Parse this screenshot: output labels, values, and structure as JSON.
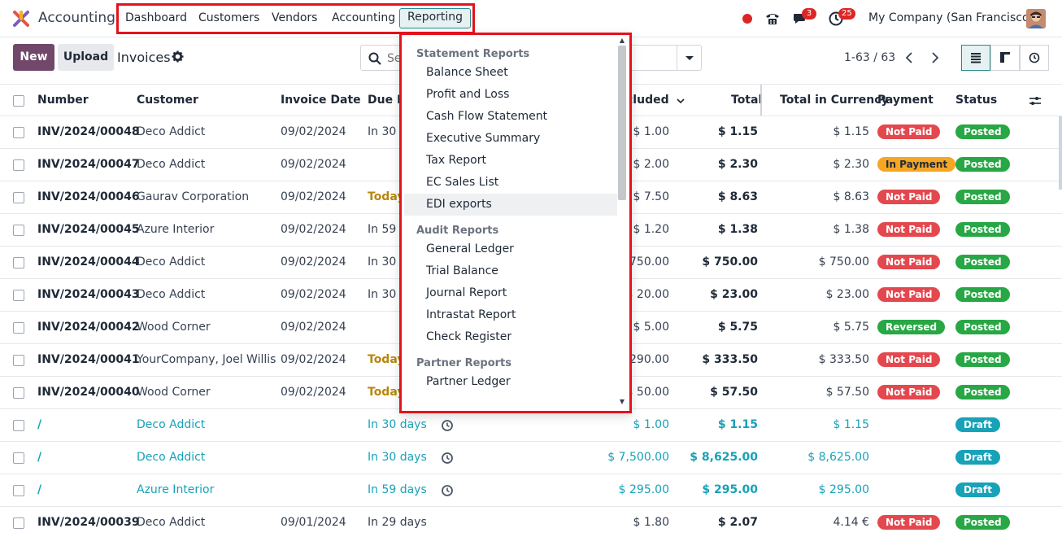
{
  "app": {
    "name": "Accounting",
    "menu": [
      "Dashboard",
      "Customers",
      "Vendors",
      "Accounting",
      "Reporting"
    ],
    "active_menu": "Reporting",
    "chat_count": "3",
    "activity_count": "25",
    "company": "My Company (San Francisco)"
  },
  "control": {
    "new_label": "New",
    "upload_label": "Upload",
    "breadcrumb": "Invoices",
    "search_placeholder": "Se",
    "pager": "1-63 / 63"
  },
  "table": {
    "columns": [
      "Number",
      "Customer",
      "Invoice Date",
      "Due D",
      "cluded",
      "Total",
      "Total in Currency",
      "Payment",
      "Status"
    ],
    "rows": [
      {
        "number": "INV/2024/00048",
        "customer": "Deco Addict",
        "date": "09/02/2024",
        "due": "In 30 d",
        "due_style": "",
        "tax_excl": "$ 1.00",
        "total": "$ 1.15",
        "currency": "$ 1.15",
        "payment": "Not Paid",
        "status": "Posted"
      },
      {
        "number": "INV/2024/00047",
        "customer": "Deco Addict",
        "date": "09/02/2024",
        "due": "",
        "due_style": "",
        "tax_excl": "$ 2.00",
        "total": "$ 2.30",
        "currency": "$ 2.30",
        "payment": "In Payment",
        "status": "Posted"
      },
      {
        "number": "INV/2024/00046",
        "customer": "Gaurav Corporation",
        "date": "09/02/2024",
        "due": "Today",
        "due_style": "today",
        "tax_excl": "$ 7.50",
        "total": "$ 8.63",
        "currency": "$ 8.63",
        "payment": "Not Paid",
        "status": "Posted"
      },
      {
        "number": "INV/2024/00045",
        "customer": "Azure Interior",
        "date": "09/02/2024",
        "due": "In 59 d",
        "due_style": "",
        "tax_excl": "$ 1.20",
        "total": "$ 1.38",
        "currency": "$ 1.38",
        "payment": "Not Paid",
        "status": "Posted"
      },
      {
        "number": "INV/2024/00044",
        "customer": "Deco Addict",
        "date": "09/02/2024",
        "due": "In 30 d",
        "due_style": "",
        "tax_excl": "$ 750.00",
        "total": "$ 750.00",
        "currency": "$ 750.00",
        "payment": "Not Paid",
        "status": "Posted"
      },
      {
        "number": "INV/2024/00043",
        "customer": "Deco Addict",
        "date": "09/02/2024",
        "due": "In 30 d",
        "due_style": "",
        "tax_excl": "$ 20.00",
        "total": "$ 23.00",
        "currency": "$ 23.00",
        "payment": "Not Paid",
        "status": "Posted"
      },
      {
        "number": "INV/2024/00042",
        "customer": "Wood Corner",
        "date": "09/02/2024",
        "due": "",
        "due_style": "",
        "tax_excl": "$ 5.00",
        "total": "$ 5.75",
        "currency": "$ 5.75",
        "payment": "Reversed",
        "status": "Posted"
      },
      {
        "number": "INV/2024/00041",
        "customer": "YourCompany, Joel Willis",
        "date": "09/02/2024",
        "due": "Today",
        "due_style": "today",
        "tax_excl": "$ 290.00",
        "total": "$ 333.50",
        "currency": "$ 333.50",
        "payment": "Not Paid",
        "status": "Posted"
      },
      {
        "number": "INV/2024/00040",
        "customer": "Wood Corner",
        "date": "09/02/2024",
        "due": "Today",
        "due_style": "today",
        "tax_excl": "$ 50.00",
        "total": "$ 57.50",
        "currency": "$ 57.50",
        "payment": "Not Paid",
        "status": "Posted"
      },
      {
        "number": "/",
        "customer": "Deco Addict",
        "date": "",
        "due": "In 30 days",
        "due_style": "draft",
        "tax_excl": "$ 1.00",
        "total": "$ 1.15",
        "currency": "$ 1.15",
        "payment": "",
        "status": "Draft"
      },
      {
        "number": "/",
        "customer": "Deco Addict",
        "date": "",
        "due": "In 30 days",
        "due_style": "draft",
        "tax_excl": "$ 7,500.00",
        "total": "$ 8,625.00",
        "currency": "$ 8,625.00",
        "payment": "",
        "status": "Draft"
      },
      {
        "number": "/",
        "customer": "Azure Interior",
        "date": "",
        "due": "In 59 days",
        "due_style": "draft",
        "tax_excl": "$ 295.00",
        "total": "$ 295.00",
        "currency": "$ 295.00",
        "payment": "",
        "status": "Draft"
      },
      {
        "number": "INV/2024/00039",
        "customer": "Deco Addict",
        "date": "09/01/2024",
        "due": "In 29 days",
        "due_style": "",
        "tax_excl": "$ 1.80",
        "total": "$ 2.07",
        "currency": "4.14 €",
        "payment": "Not Paid",
        "status": "Posted"
      }
    ]
  },
  "reporting_menu": {
    "sections": [
      {
        "title": "Statement Reports",
        "items": [
          "Balance Sheet",
          "Profit and Loss",
          "Cash Flow Statement",
          "Executive Summary",
          "Tax Report",
          "EC Sales List",
          "EDI exports"
        ]
      },
      {
        "title": "Audit Reports",
        "items": [
          "General Ledger",
          "Trial Balance",
          "Journal Report",
          "Intrastat Report",
          "Check Register"
        ]
      },
      {
        "title": "Partner Reports",
        "items": [
          "Partner Ledger"
        ]
      }
    ],
    "hovered_item": "EDI exports"
  },
  "colors": {
    "brand": "#71486a",
    "teal": "#2b8a8c",
    "highlight_frame": "#e4121c",
    "not_paid": "#e4484f",
    "in_payment": "#f5a623",
    "reversed": "#28a745",
    "posted": "#28a745",
    "draft": "#17a2b8"
  }
}
